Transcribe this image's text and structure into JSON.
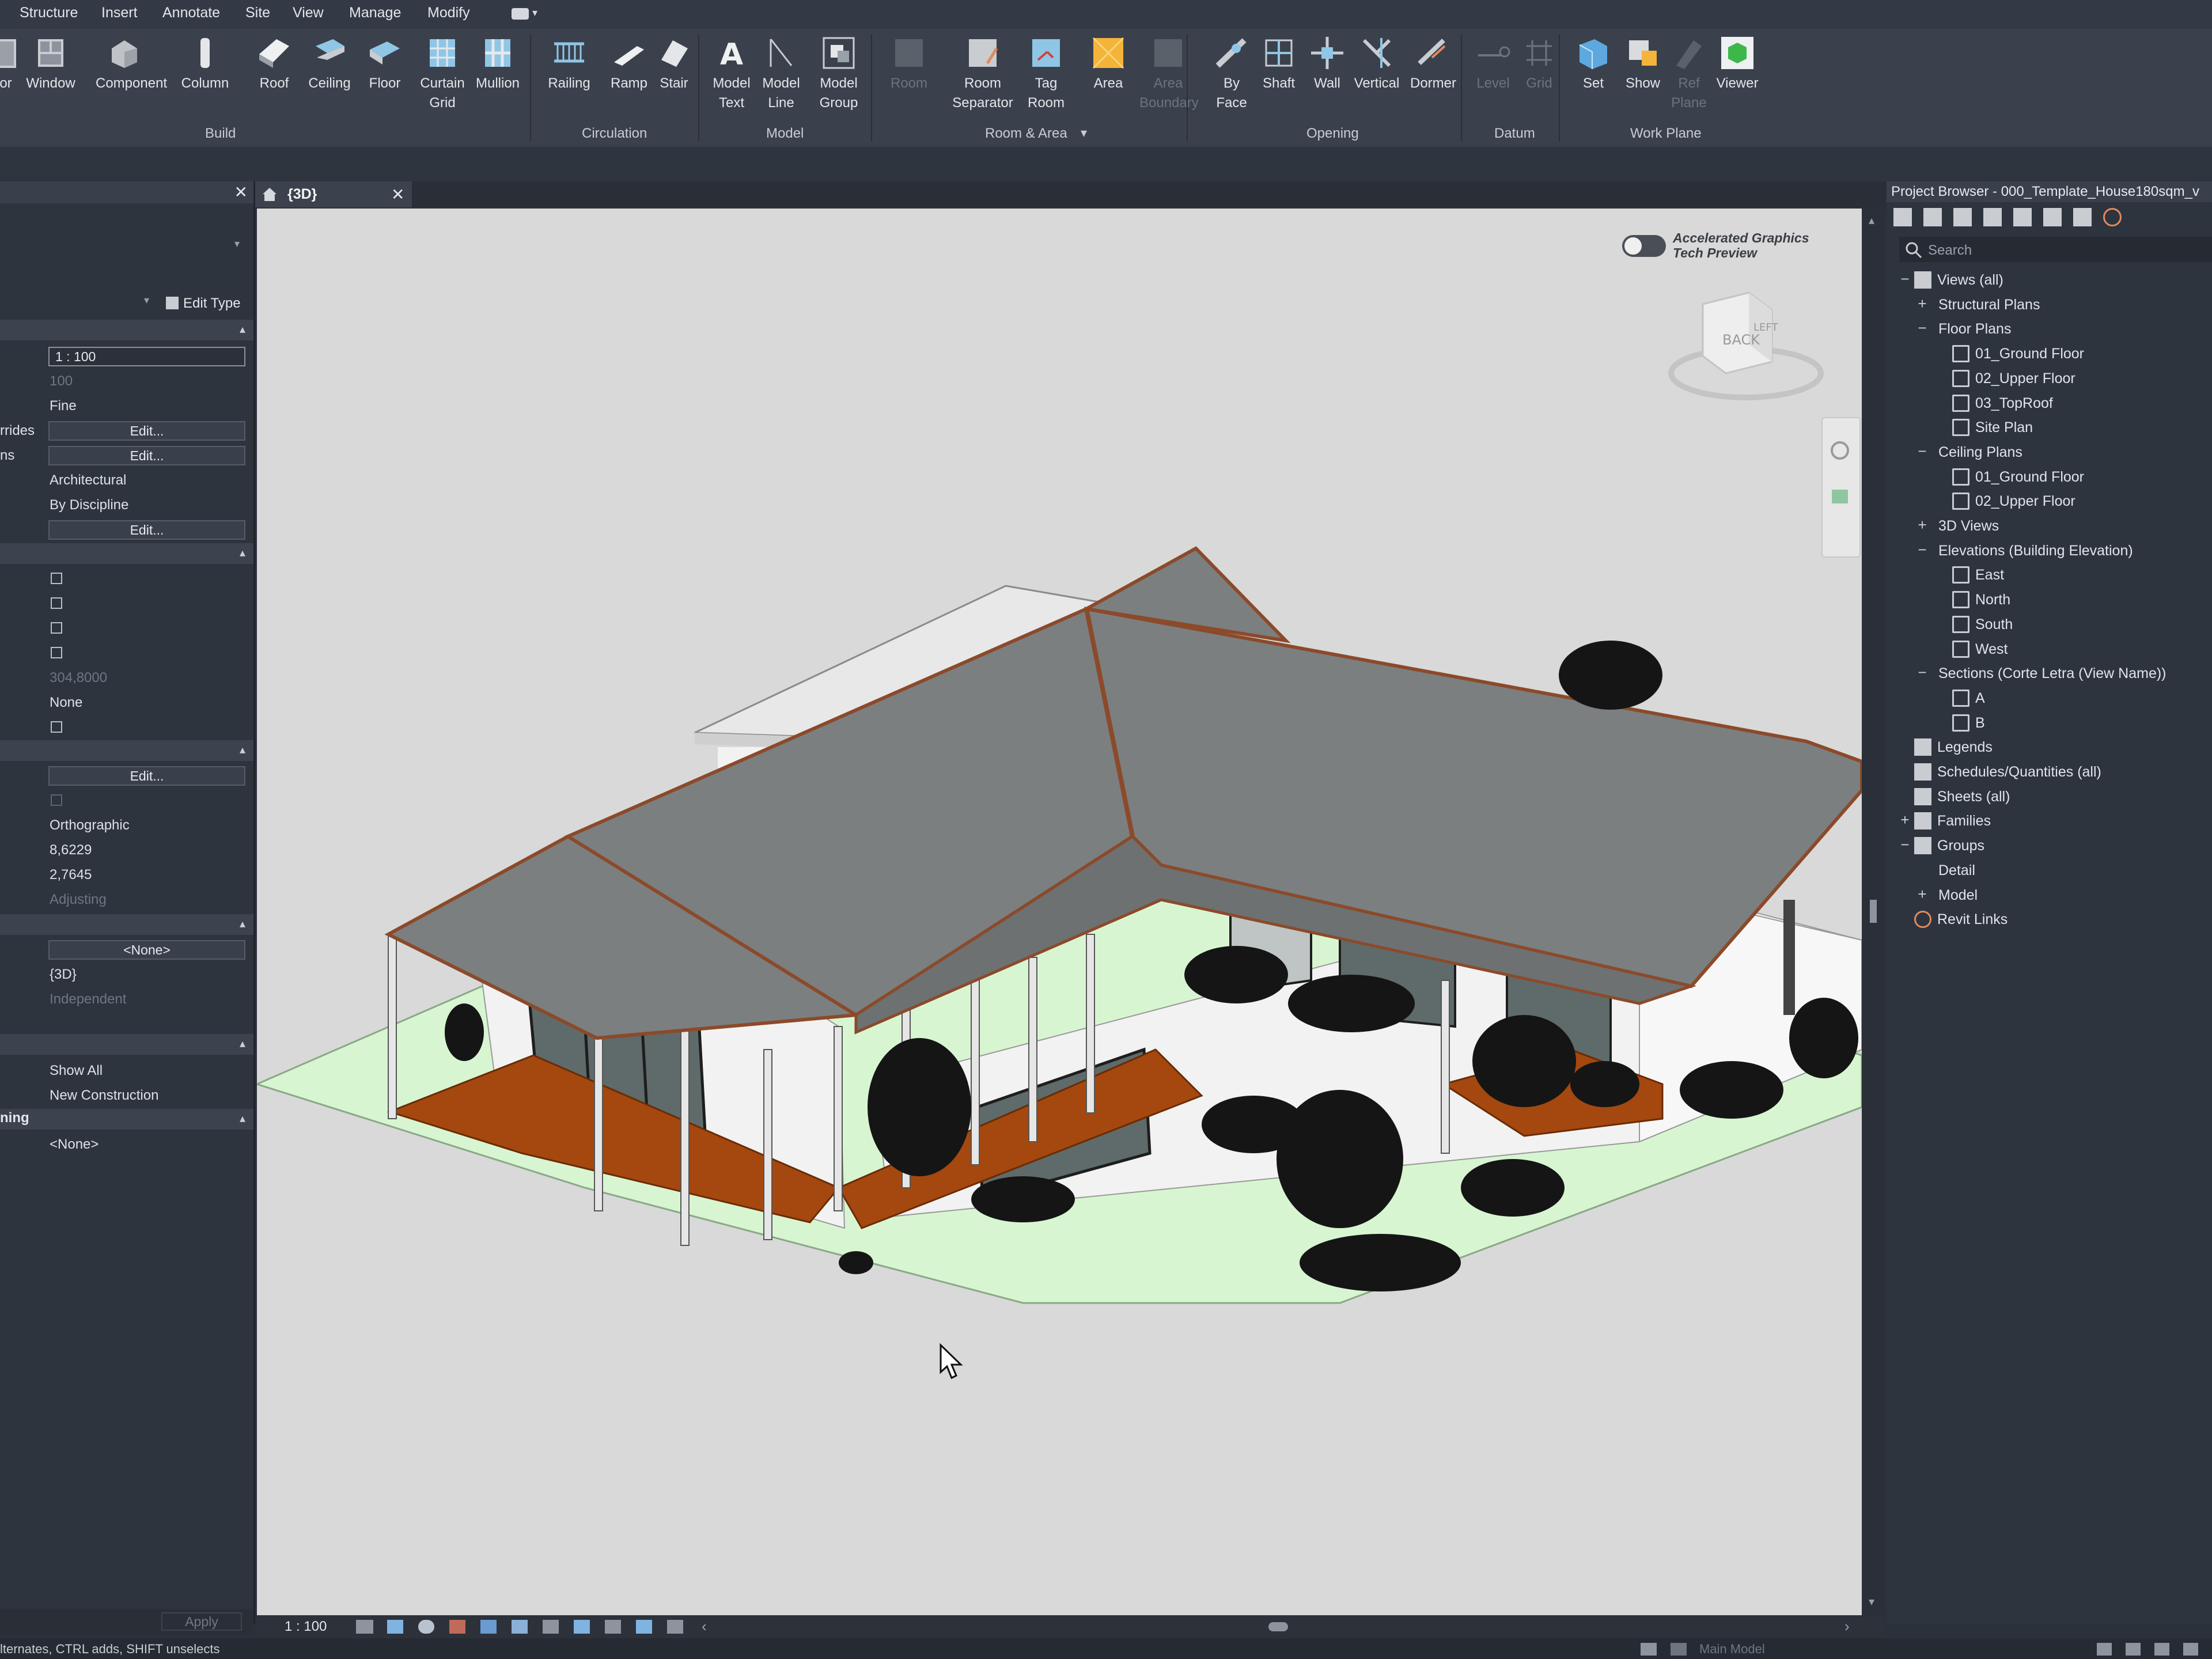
{
  "menu": [
    "Structure",
    "Insert",
    "Annotate",
    "Site",
    "View",
    "Manage",
    "Modify"
  ],
  "ribbon": {
    "tools": [
      {
        "label": "or",
        "icon": "door-icon"
      },
      {
        "label": "Window",
        "icon": "window-icon"
      },
      {
        "label": "Component",
        "icon": "component-icon"
      },
      {
        "label": "Column",
        "icon": "column-icon"
      },
      {
        "label": "Roof",
        "icon": "roof-icon"
      },
      {
        "label": "Ceiling",
        "icon": "ceiling-icon"
      },
      {
        "label": "Floor",
        "icon": "floor-icon"
      },
      {
        "label": "Curtain\nGrid",
        "icon": "curtain-grid-icon"
      },
      {
        "label": "Mullion",
        "icon": "mullion-icon"
      },
      {
        "label": "Railing",
        "icon": "railing-icon"
      },
      {
        "label": "Ramp",
        "icon": "ramp-icon"
      },
      {
        "label": "Stair",
        "icon": "stair-icon"
      },
      {
        "label": "Model\nText",
        "icon": "model-text-icon"
      },
      {
        "label": "Model\nLine",
        "icon": "model-line-icon"
      },
      {
        "label": "Model\nGroup",
        "icon": "model-group-icon"
      },
      {
        "label": "Room",
        "icon": "room-icon"
      },
      {
        "label": "Room\nSeparator",
        "icon": "room-separator-icon"
      },
      {
        "label": "Tag\nRoom",
        "icon": "tag-room-icon"
      },
      {
        "label": "Area",
        "icon": "area-icon"
      },
      {
        "label": "Area\nBoundary",
        "icon": "area-boundary-icon"
      },
      {
        "label": "By\nFace",
        "icon": "by-face-icon"
      },
      {
        "label": "Shaft",
        "icon": "shaft-icon"
      },
      {
        "label": "Wall",
        "icon": "wall-opening-icon"
      },
      {
        "label": "Vertical",
        "icon": "vertical-icon"
      },
      {
        "label": "Dormer",
        "icon": "dormer-icon"
      },
      {
        "label": "Level",
        "icon": "level-icon"
      },
      {
        "label": "Grid",
        "icon": "grid-icon"
      },
      {
        "label": "Set",
        "icon": "set-icon"
      },
      {
        "label": "Show",
        "icon": "show-icon"
      },
      {
        "label": "Ref\nPlane",
        "icon": "ref-plane-icon"
      },
      {
        "label": "Viewer",
        "icon": "viewer-icon"
      }
    ],
    "panels": [
      "Build",
      "Circulation",
      "Model",
      "Room & Area",
      "Opening",
      "Datum",
      "Work Plane"
    ]
  },
  "properties": {
    "edit_type": "Edit Type",
    "rows": {
      "scale": "1 : 100",
      "scale_value": "100",
      "detail_level": "Fine",
      "overrides_key": "rrides",
      "edit": "Edit...",
      "ns_key": "ns",
      "discipline": "Architectural",
      "color_scheme": "By Discipline",
      "eye_elevation": "304,8000",
      "none": "None",
      "orthographic": "Orthographic",
      "value_a": "8,6229",
      "value_b": "2,7645",
      "adjusting": "Adjusting",
      "none_bracket": "<None>",
      "view_name": "{3D}",
      "independent": "Independent",
      "show_all": "Show All",
      "new_construction": "New Construction",
      "ning_key": "ning",
      "apply": "Apply"
    }
  },
  "view": {
    "tab_label": "{3D}",
    "accel_line1": "Accelerated Graphics",
    "accel_line2": "Tech Preview",
    "viewcube_back": "BACK",
    "viewcube_left": "LEFT",
    "scale": "1 : 100"
  },
  "browser": {
    "title": "Project Browser - 000_Template_House180sqm_v",
    "search_placeholder": "Search",
    "tree": [
      {
        "label": "Views (all)",
        "level": 0,
        "exp": "−",
        "icon": "views-icon"
      },
      {
        "label": "Structural Plans",
        "level": 1,
        "exp": "+"
      },
      {
        "label": "Floor Plans",
        "level": 1,
        "exp": "−"
      },
      {
        "label": "01_Ground Floor",
        "level": 2,
        "icon": "view-icon"
      },
      {
        "label": "02_Upper Floor",
        "level": 2,
        "icon": "view-icon"
      },
      {
        "label": "03_TopRoof",
        "level": 2,
        "icon": "view-icon"
      },
      {
        "label": "Site Plan",
        "level": 2,
        "icon": "view-icon"
      },
      {
        "label": "Ceiling Plans",
        "level": 1,
        "exp": "−"
      },
      {
        "label": "01_Ground Floor",
        "level": 2,
        "icon": "view-icon"
      },
      {
        "label": "02_Upper Floor",
        "level": 2,
        "icon": "view-icon"
      },
      {
        "label": "3D Views",
        "level": 1,
        "exp": "+"
      },
      {
        "label": "Elevations (Building Elevation)",
        "level": 1,
        "exp": "−"
      },
      {
        "label": "East",
        "level": 2,
        "icon": "view-icon"
      },
      {
        "label": "North",
        "level": 2,
        "icon": "view-icon"
      },
      {
        "label": "South",
        "level": 2,
        "icon": "view-icon"
      },
      {
        "label": "West",
        "level": 2,
        "icon": "view-icon"
      },
      {
        "label": "Sections (Corte Letra (View Name))",
        "level": 1,
        "exp": "−"
      },
      {
        "label": "A",
        "level": 2,
        "icon": "view-icon"
      },
      {
        "label": "B",
        "level": 2,
        "icon": "view-icon"
      },
      {
        "label": "Legends",
        "level": 0,
        "icon": "legends-icon"
      },
      {
        "label": "Schedules/Quantities (all)",
        "level": 0,
        "icon": "schedules-icon"
      },
      {
        "label": "Sheets (all)",
        "level": 0,
        "icon": "sheets-icon"
      },
      {
        "label": "Families",
        "level": 0,
        "exp": "+",
        "icon": "families-icon"
      },
      {
        "label": "Groups",
        "level": 0,
        "exp": "−",
        "icon": "groups-icon"
      },
      {
        "label": "Detail",
        "level": 1
      },
      {
        "label": "Model",
        "level": 1,
        "exp": "+"
      },
      {
        "label": "Revit Links",
        "level": 0,
        "icon": "revit-links-icon"
      }
    ]
  },
  "status": {
    "hint": "lternates, CTRL adds, SHIFT unselects",
    "model": "Main Model"
  },
  "colors": {
    "roof": "#7b7f80",
    "deck": "#a4480f",
    "lawn": "#d8f5d2",
    "wall": "#f2f2f2"
  }
}
